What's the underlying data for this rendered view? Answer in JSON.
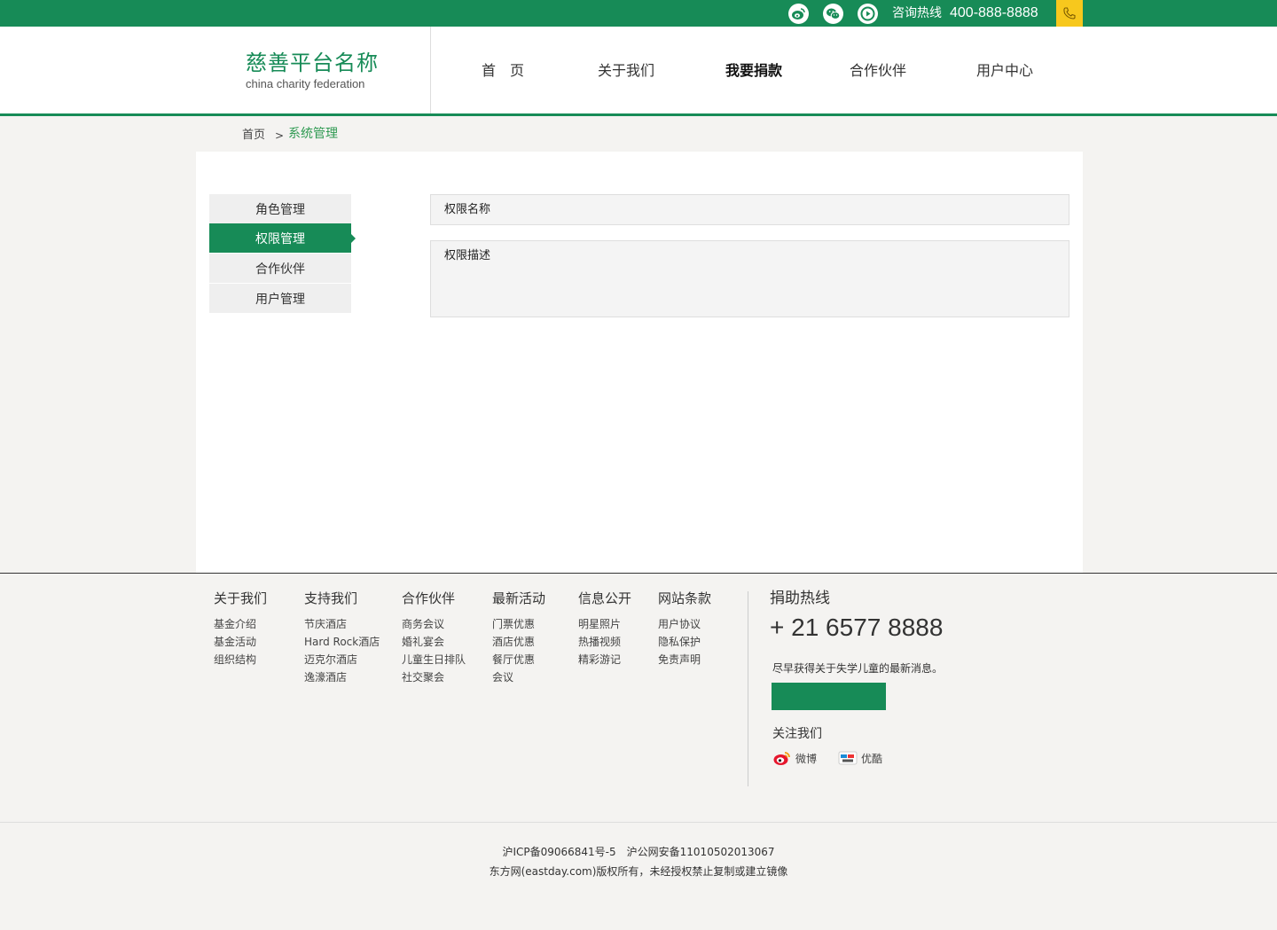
{
  "topbar": {
    "social_icons": [
      "weibo-icon",
      "wechat-icon",
      "video-play-icon"
    ],
    "hotline_label": "咨询热线",
    "hotline_number": "400-888-8888",
    "phone_icon": "phone-icon"
  },
  "header": {
    "logo_cn": "慈善平台名称",
    "logo_en": "china charity federation",
    "nav": [
      "首　页",
      "关于我们",
      "我要捐款",
      "合作伙伴",
      "用户中心"
    ],
    "active_nav": "我要捐款"
  },
  "breadcrumb": {
    "home": "首页",
    "separator": ">",
    "current": "系统管理"
  },
  "sidebar": {
    "items": [
      "角色管理",
      "权限管理",
      "合作伙伴",
      "用户管理"
    ],
    "active": "权限管理"
  },
  "form": {
    "name_label": "权限名称",
    "desc_label": "权限描述"
  },
  "footer": {
    "columns": [
      {
        "title": "关于我们",
        "links": [
          "基金介绍",
          "基金活动",
          "组织结构"
        ]
      },
      {
        "title": "支持我们",
        "links": [
          "节庆酒店",
          "Hard Rock酒店",
          "迈克尔酒店",
          "逸濠酒店"
        ]
      },
      {
        "title": "合作伙伴",
        "links": [
          "商务会议",
          "婚礼宴会",
          "儿童生日排队",
          "社交聚会"
        ]
      },
      {
        "title": "最新活动",
        "links": [
          "门票优惠",
          "酒店优惠",
          "餐厅优惠",
          "会议"
        ]
      },
      {
        "title": "信息公开",
        "links": [
          "明星照片",
          "热播视频",
          "精彩游记"
        ]
      },
      {
        "title": "网站条款",
        "links": [
          "用户协议",
          "隐私保护",
          "免责声明"
        ]
      }
    ],
    "hotline_title": "捐助热线",
    "hotline_number": "+ 21 6577 8888",
    "news_text": "尽早获得关于失学儿童的最新消息。",
    "follow_title": "关注我们",
    "follow": [
      {
        "label": "微博",
        "icon": "weibo-icon"
      },
      {
        "label": "优酷",
        "icon": "youku-icon"
      }
    ],
    "copyright_1": "沪ICP备09066841号-5　沪公网安备11010502013067",
    "copyright_2": "东方网(eastday.com)版权所有，未经授权禁止复制或建立镜像"
  },
  "colors": {
    "brand_green": "#178b57",
    "accent_yellow": "#f7c81d",
    "page_bg": "#f4f3f1"
  }
}
